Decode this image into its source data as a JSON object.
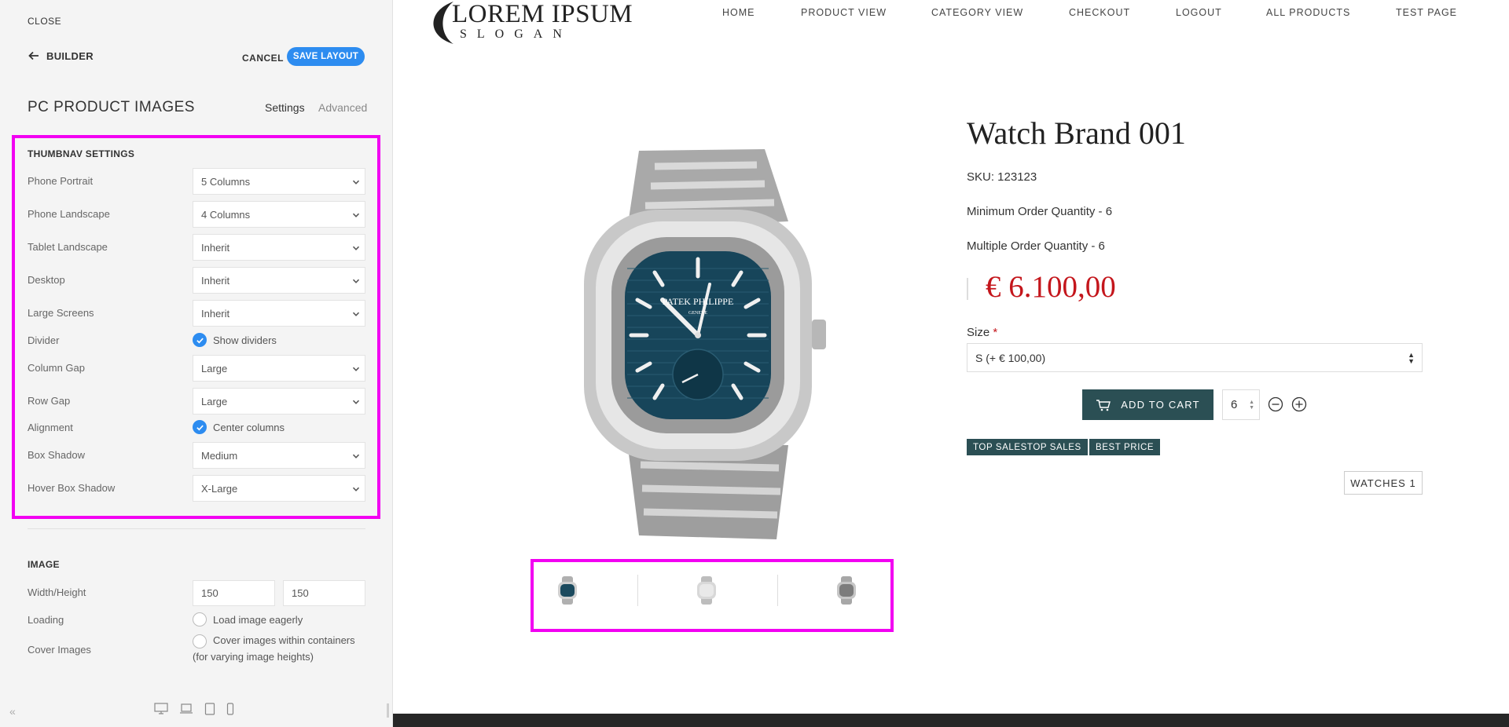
{
  "sidebar": {
    "close_label": "CLOSE",
    "back_label": "BUILDER",
    "cancel_label": "CANCEL",
    "save_label": "SAVE LAYOUT",
    "title": "PC PRODUCT IMAGES",
    "tabs": [
      {
        "label": "Settings",
        "active": true
      },
      {
        "label": "Advanced",
        "active": false
      }
    ],
    "thumbnav": {
      "heading": "THUMBNAV SETTINGS",
      "rows": [
        {
          "label": "Phone Portrait",
          "type": "select",
          "value": "5 Columns"
        },
        {
          "label": "Phone Landscape",
          "type": "select",
          "value": "4 Columns"
        },
        {
          "label": "Tablet Landscape",
          "type": "select",
          "value": "Inherit"
        },
        {
          "label": "Desktop",
          "type": "select",
          "value": "Inherit"
        },
        {
          "label": "Large Screens",
          "type": "select",
          "value": "Inherit"
        },
        {
          "label": "Divider",
          "type": "checkbox",
          "value": "Show dividers",
          "checked": true
        },
        {
          "label": "Column Gap",
          "type": "select",
          "value": "Large"
        },
        {
          "label": "Row Gap",
          "type": "select",
          "value": "Large"
        },
        {
          "label": "Alignment",
          "type": "checkbox",
          "value": "Center columns",
          "checked": true
        },
        {
          "label": "Box Shadow",
          "type": "select",
          "value": "Medium"
        },
        {
          "label": "Hover Box Shadow",
          "type": "select",
          "value": "X-Large"
        }
      ]
    },
    "image": {
      "heading": "IMAGE",
      "width_height_label": "Width/Height",
      "width_value": "150",
      "height_value": "150",
      "loading_label": "Loading",
      "loading_option": "Load image eagerly",
      "cover_label": "Cover Images",
      "cover_option_line1": "Cover images within containers",
      "cover_option_line2": "(for varying image heights)"
    },
    "collapse_label": "«"
  },
  "site": {
    "logo_text": "LOREM IPSUM",
    "logo_slogan": "SLOGAN",
    "nav": [
      "HOME",
      "PRODUCT VIEW",
      "CATEGORY VIEW",
      "CHECKOUT",
      "LOGOUT",
      "ALL PRODUCTS",
      "TEST PAGE"
    ]
  },
  "product": {
    "title": "Watch Brand 001",
    "sku": "SKU: 123123",
    "min_qty": "Minimum Order Quantity - 6",
    "mult_qty": "Multiple Order Quantity - 6",
    "price": "€ 6.100,00",
    "size_label": "Size",
    "size_required_mark": "*",
    "size_value": "S (+ € 100,00)",
    "add_to_cart": "ADD TO CART",
    "quantity": "6",
    "badges": [
      "TOP SALESTOP SALES",
      "BEST PRICE"
    ],
    "category_tag": "WATCHES 1",
    "image_dial_brand": "PATEK PHILIPPE",
    "image_dial_sub": "GENEVE"
  },
  "colors": {
    "accent_blue": "#2d8cf0",
    "highlight_magenta": "#f200f2",
    "cart_green": "#2b4f54",
    "price_red": "#c4161c"
  }
}
